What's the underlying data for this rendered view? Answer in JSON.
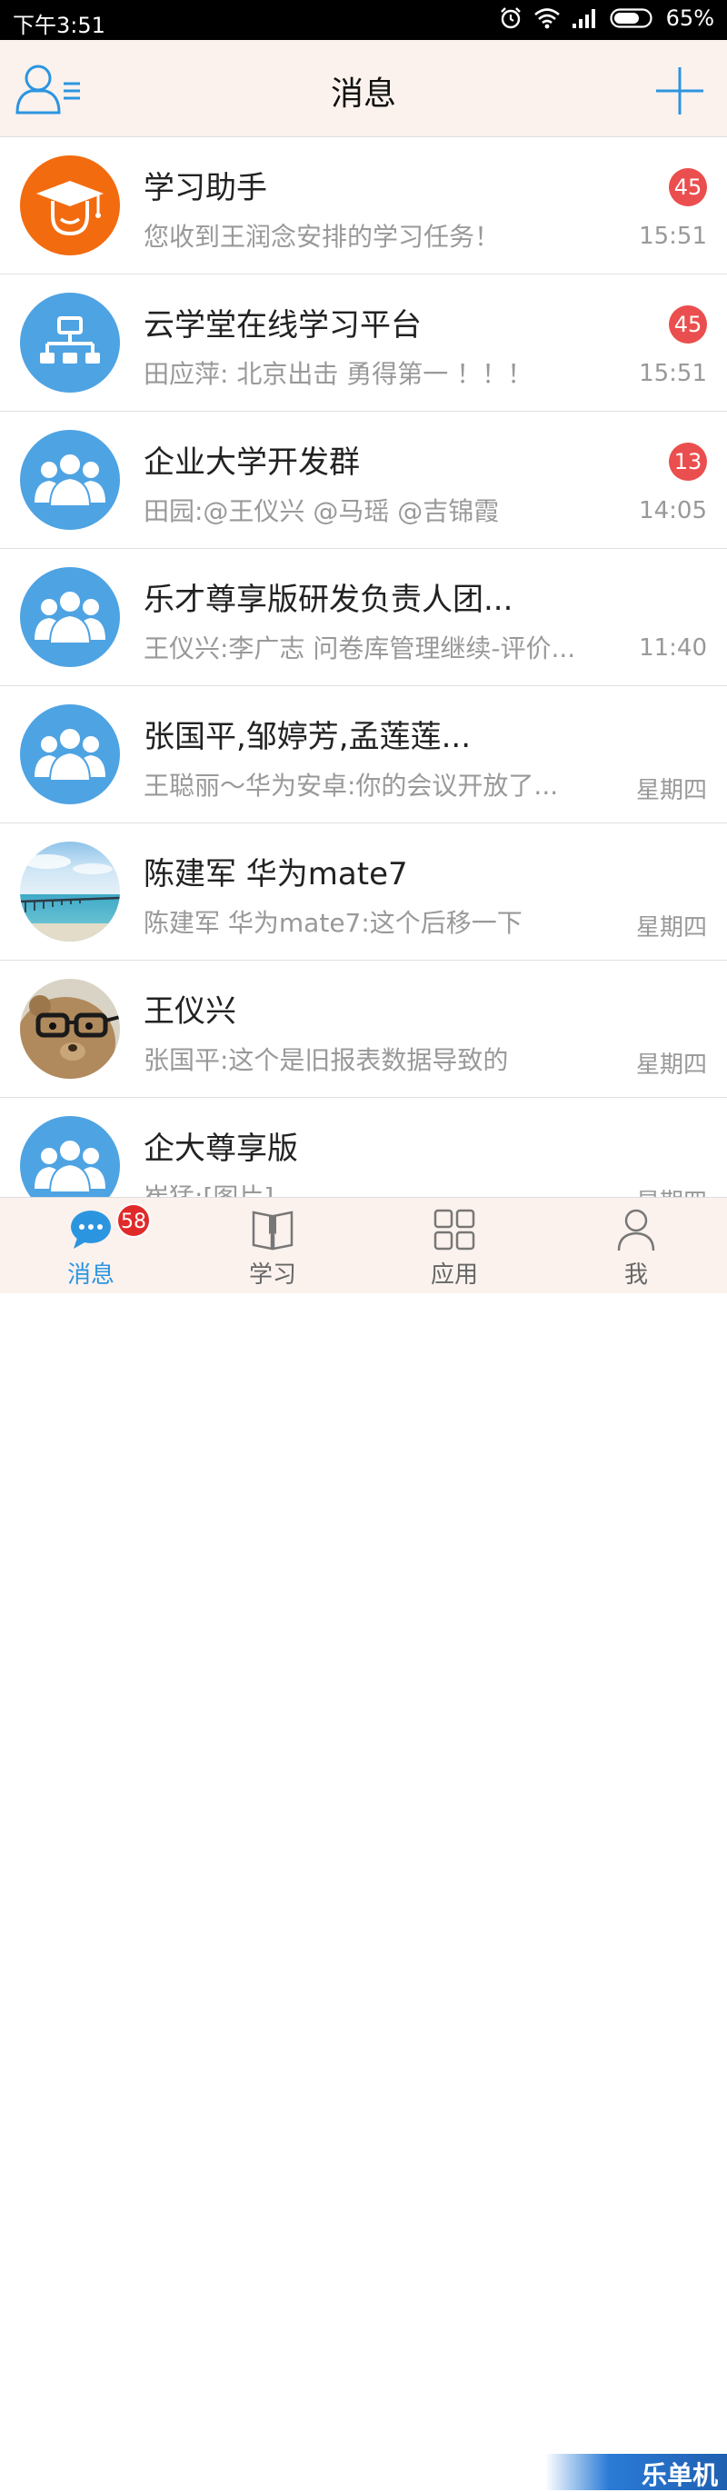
{
  "status_bar": {
    "time": "下午3:51",
    "battery": "65%"
  },
  "header": {
    "title": "消息"
  },
  "conversations": [
    {
      "name": "学习助手",
      "preview": "您收到王润念安排的学习任务！",
      "time": "15:51",
      "badge": "45",
      "avatar": "graduation-cap-icon"
    },
    {
      "name": "云学堂在线学习平台",
      "preview": "田应萍: 北京出击  勇得第一 ！！！",
      "time": "15:51",
      "badge": "45",
      "avatar": "org-chart-icon"
    },
    {
      "name": "企业大学开发群",
      "preview": "田园:@王仪兴 @马瑶 @吉锦霞",
      "time": "14:05",
      "badge": "13",
      "avatar": "group-icon"
    },
    {
      "name": "乐才尊享版研发负责人团...",
      "preview": "王仪兴:李广志 问卷库管理继续-评价...",
      "time": "11:40",
      "badge": null,
      "avatar": "group-icon"
    },
    {
      "name": "张国平,邹婷芳,孟莲莲...",
      "preview": "王聪丽～华为安卓:你的会议开放了...",
      "time": "星期四",
      "badge": null,
      "avatar": "group-icon"
    },
    {
      "name": "陈建军 华为mate7",
      "preview": "陈建军 华为mate7:这个后移一下",
      "time": "星期四",
      "badge": null,
      "avatar": "pier-photo"
    },
    {
      "name": "王仪兴",
      "preview": "张国平:这个是旧报表数据导致的",
      "time": "星期四",
      "badge": null,
      "avatar": "teddy-bear-photo"
    },
    {
      "name": "企大尊享版",
      "preview": "崔猛:[图片]",
      "time": "星期四",
      "badge": null,
      "avatar": "group-icon"
    }
  ],
  "tabs": [
    {
      "label": "消息",
      "icon": "chat-bubble-icon",
      "active": true,
      "badge": "58"
    },
    {
      "label": "学习",
      "icon": "book-icon",
      "active": false
    },
    {
      "label": "应用",
      "icon": "apps-grid-icon",
      "active": false
    },
    {
      "label": "我",
      "icon": "person-icon",
      "active": false
    }
  ],
  "watermark": "乐单机",
  "colors": {
    "accent": "#2c95e0",
    "badge": "#eb4e4e",
    "orange_avatar": "#f36b0f",
    "blue_avatar": "#4ea3e3"
  }
}
